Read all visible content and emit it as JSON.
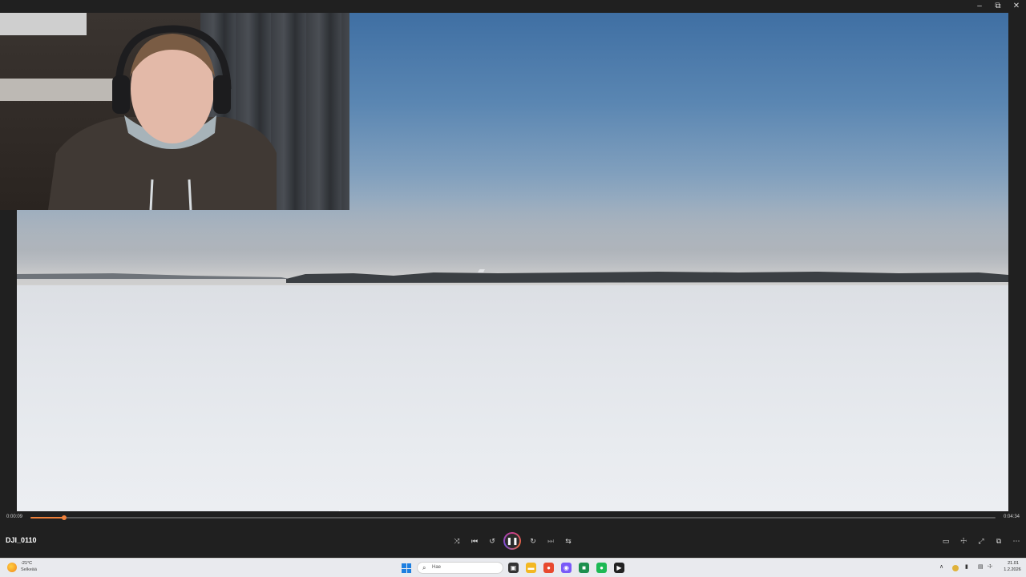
{
  "window": {
    "minimize_glyph": "–",
    "restore_glyph": "⧉",
    "close_glyph": "✕"
  },
  "player": {
    "title": "DJI_0110",
    "current_time": "0:00:09",
    "total_time": "0:04:34",
    "progress_fraction": 0.035,
    "accent_color": "#f0813b",
    "controls": {
      "shuffle_icon": "⤨",
      "previous_icon": "⏮",
      "rewind_icon": "↺",
      "pause_icon": "❚❚",
      "forward_icon": "↻",
      "next_icon": "⏭",
      "repeat_icon": "⇆",
      "miniplayer_icon": "▭",
      "volume_icon": "☩",
      "fullscreen_icon": "⤢",
      "pip_icon": "⧉",
      "more_icon": "⋯"
    }
  },
  "taskbar": {
    "weather_temp": "-21°C",
    "weather_desc": "Selkeää",
    "search_placeholder": "Hae",
    "clock_time": "21.01",
    "clock_date": "1.2.2026",
    "apps": [
      {
        "name": "task-view-icon",
        "glyph": "▣",
        "color": "#333333"
      },
      {
        "name": "file-explorer-icon",
        "glyph": "▬",
        "color": "#f3b822"
      },
      {
        "name": "firefox-icon",
        "glyph": "●",
        "color": "#e8492e"
      },
      {
        "name": "messenger-icon",
        "glyph": "◉",
        "color": "#7a5af8"
      },
      {
        "name": "terminal-icon",
        "glyph": "■",
        "color": "#1d8f4e"
      },
      {
        "name": "spotify-icon",
        "glyph": "●",
        "color": "#1db954"
      },
      {
        "name": "media-player-icon",
        "glyph": "▶",
        "color": "#222222"
      }
    ],
    "tray": {
      "chevron_icon": "∧",
      "network_icon": "▤",
      "volume_icon": "☩"
    }
  }
}
